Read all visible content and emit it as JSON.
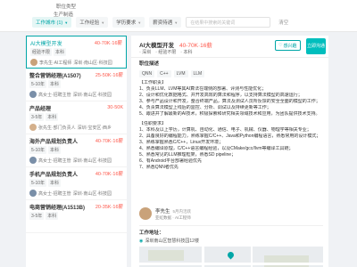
{
  "nav": {
    "tabs": [
      "职位类型",
      "生产制造"
    ]
  },
  "filters": [
    {
      "label": "工作城市 (1)",
      "active": true
    },
    {
      "label": "工作经验",
      "active": false
    },
    {
      "label": "学历要求",
      "active": false
    },
    {
      "label": "薪资待遇",
      "active": false
    }
  ],
  "search": {
    "placeholder": "在结果中搜索的关键词"
  },
  "clear_label": "清空",
  "jobs": [
    {
      "title": "AI大模型开发",
      "salary": "40-70K·16薪",
      "tags": [
        "经验不限",
        "本科"
      ],
      "recruiter": "李先生·AI工程师",
      "location": "深圳·南山区·科技园",
      "selected": true
    },
    {
      "title": "整合营销经理(A1507)",
      "salary": "25-50K·16薪",
      "tags": [
        "5-10年",
        "本科"
      ],
      "recruiter": "高女士·招聘主管",
      "location": "深圳·南山区·科技园",
      "selected": false
    },
    {
      "title": "产品经理",
      "salary": "30-50K",
      "tags": [
        "3-5年",
        "本科"
      ],
      "recruiter": "张先生·部门负责人",
      "location": "深圳·宝安区·西乡",
      "selected": false
    },
    {
      "title": "海外产品规划负责人",
      "salary": "40-70K·16薪",
      "tags": [
        "5-10年",
        "本科"
      ],
      "recruiter": "高女士·招聘主管",
      "location": "深圳·南山区·科技园",
      "selected": false
    },
    {
      "title": "手机产品规划负责人",
      "salary": "40-70K·16薪",
      "tags": [
        "5-10年",
        "本科"
      ],
      "recruiter": "高女士·招聘主管",
      "location": "深圳·南山区·科技园",
      "selected": false
    },
    {
      "title": "电商营销经理(A1513B)",
      "salary": "20-35K·16薪",
      "tags": [
        "3-5年",
        "本科"
      ],
      "recruiter": "",
      "location": "",
      "selected": false
    }
  ],
  "detail": {
    "title": "AI大模型开发",
    "salary": "40-70K·16薪",
    "meta": [
      "深圳",
      "经验不限",
      "本科"
    ],
    "interested_label": "感兴趣",
    "chat_label": "立即沟通",
    "section_title": "职位描述",
    "skills": [
      "QNN",
      "C++",
      "LVM",
      "LLM"
    ],
    "description": [
      "【工作职责】",
      "1、负责LLM、LVM等其AI算法在端侧的部署、评测与性能优化；",
      "2、设计和优化数据格式、并开发高效的算法和程序，以支持算法模型的高速运行；",
      "3、参与产品设计和开发，整合终端产品，算法及测试人员所反馈的安全全面的模型的工作；",
      "4、负责算法模型上线后的监控、分析、调试以及持续更新等工作；",
      "5、跟进并了解最新的AI技术，积极探索和研究相关领域技术和应用，为团队提供技术支持。",
      "",
      "【任职要求】",
      "1、本科及以上学历，计算机、自动化、通信、电子、机械、仪器、物理学等相关专业；",
      "2、具备良好的编程能力，熟练掌握C/C++、Java和Python编程语言，熟悉常用的设计模式；",
      "3、熟练掌握熟悉C/C++，Linux开发环境；",
      "4、熟悉编译原理，C/C++语言编程经验，以及CMake/gcc/llvm等编译工具链；",
      "5、熟悉常见的LLM推理框架，熟悉SD pipeline；",
      "6、有Android平台部署经验优先",
      "7、熟悉QNN者优先"
    ],
    "recruiter": {
      "name": "李先生",
      "active": "5月内活跃",
      "company": "亚虹数据 · AI工程师"
    },
    "address_title": "工作地址：",
    "address": "深圳南山区智慧科技园12楼"
  }
}
